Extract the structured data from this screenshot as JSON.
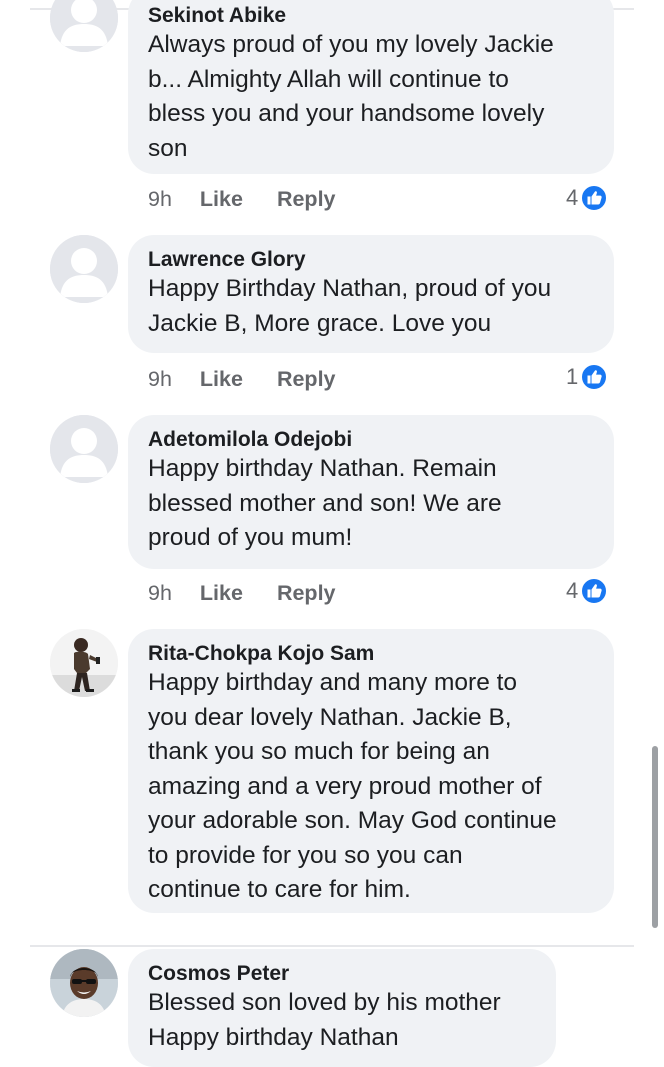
{
  "comments": [
    {
      "name": "Sekinot Abike",
      "text": "Always proud of you my lovely Jackie\nb... Almighty Allah will continue to\nbless you and your handsome lovely\nson",
      "time": "9h",
      "like_label": "Like",
      "reply_label": "Reply",
      "reactions": "4"
    },
    {
      "name": "Lawrence Glory",
      "text": "Happy Birthday Nathan, proud of you\nJackie B, More grace. Love you",
      "time": "9h",
      "like_label": "Like",
      "reply_label": "Reply",
      "reactions": "1"
    },
    {
      "name": "Adetomilola Odejobi",
      "text": "Happy birthday Nathan. Remain\nblessed mother and son! We are\nproud of you mum!",
      "time": "9h",
      "like_label": "Like",
      "reply_label": "Reply",
      "reactions": "4"
    },
    {
      "name": "Rita-Chokpa Kojo Sam",
      "text": "Happy birthday and many more to\nyou dear lovely Nathan. Jackie B,\nthank you so much for being an\namazing and a very proud mother of\nyour adorable son. May God continue\nto provide for you so you can\ncontinue to care for him."
    },
    {
      "name": "Cosmos Peter",
      "text": "Blessed son loved by his mother\nHappy birthday Nathan"
    }
  ],
  "colors": {
    "bubble": "#f0f2f5",
    "like_blue": "#1877f2",
    "meta_gray": "#65676b"
  },
  "icons": {
    "avatar_default": "default-avatar-icon",
    "like_reaction": "like-reaction-icon"
  }
}
